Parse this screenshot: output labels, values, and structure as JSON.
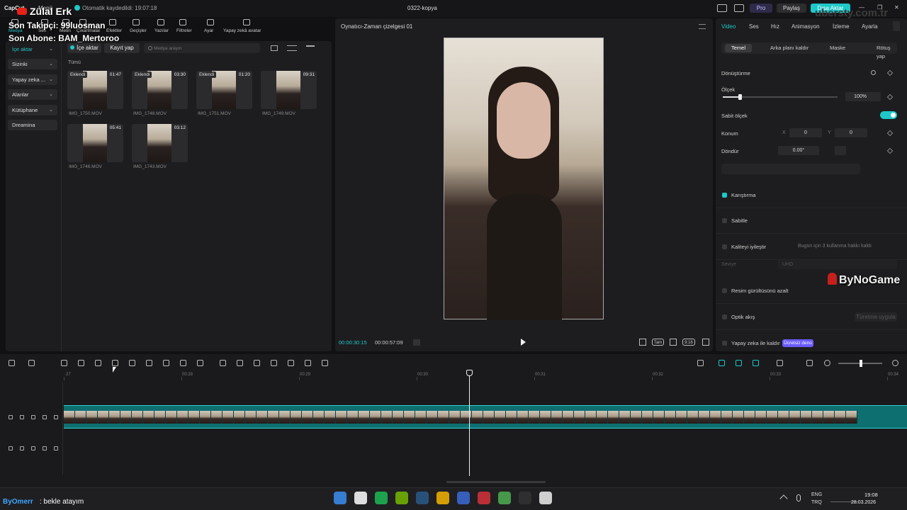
{
  "overlay": {
    "channel": "Zülal Erk",
    "follower": "Son Takipçi: 99luosman",
    "subscriber": "Son Abone: BAM_Mertoroo",
    "watermark": "ByNoGame",
    "site": "ubersty.com.tr",
    "chat_user": "ByOmerr",
    "chat_msg": ": bekle atayım"
  },
  "titlebar": {
    "app": "CapCut",
    "menu": "Menü",
    "autosave": "Otomatik kaydedildi: 19:07:18",
    "project": "0322-kopya",
    "pro": "Pro",
    "share": "Paylaş",
    "export": "Dışa Aktar",
    "min": "—",
    "max": "❐",
    "close": "✕"
  },
  "toolbar": {
    "items": [
      "Medya",
      "Ses",
      "Metin",
      "Çıkartmalar",
      "Efektler",
      "Geçişler",
      "Yazılar",
      "Filtreler",
      "Ayar",
      "Yapay zekâ avatar"
    ]
  },
  "media": {
    "sidebar": [
      "İçe aktar",
      "Sizinki",
      "Yapay zeka ...",
      "Alanlar",
      "Kütüphane",
      "Dreamina"
    ],
    "import_btn": "İçe aktar",
    "record_btn": "Kayıt yap",
    "search_placeholder": "Medya arayın",
    "all": "Tümü",
    "clips": [
      {
        "badge": "Eklendi",
        "dur": "01:47",
        "name": "IMG_1750.MOV"
      },
      {
        "badge": "Eklendi",
        "dur": "03:30",
        "name": "IMG_1748.MOV"
      },
      {
        "badge": "Eklendi",
        "dur": "01:20",
        "name": "IMG_1751.MOV"
      },
      {
        "badge": "",
        "dur": "09:31",
        "name": "IMG_1749.MOV"
      },
      {
        "badge": "",
        "dur": "05:41",
        "name": "IMG_1746.MOV"
      },
      {
        "badge": "",
        "dur": "03:12",
        "name": "IMG_1743.MOV"
      }
    ]
  },
  "player": {
    "title": "Oynatıcı-Zaman çizelgesi 01",
    "current": "00:00:30:15",
    "total": "00:00:57:09",
    "ratio": "9:16",
    "full": "Tam"
  },
  "props": {
    "tabs": [
      "Video",
      "Ses",
      "Hız",
      "Animasyon",
      "İzleme",
      "Ayarla"
    ],
    "subtabs": [
      "Temel",
      "Arka planı kaldır",
      "Maske",
      "Rötuş yap"
    ],
    "transform": "Dönüştürme",
    "scale": "Ölçek",
    "scale_val": "100%",
    "scale_fraction": 0.15,
    "uniform": "Sabit ölçek",
    "position": "Konum",
    "x_label": "X",
    "x_val": "0",
    "y_label": "Y",
    "y_val": "0",
    "rotate": "Döndür",
    "rotate_val": "0.00°",
    "blend": "Karıştırma",
    "stabilize": "Sabitle",
    "enhance": "Kaliteyi iyileştir",
    "enhance_note": "Bugün için 3 kullanma hakkı kaldı",
    "level": "Seviye",
    "level_val": "UHD",
    "denoise": "Resim gürültüsünü azalt",
    "flow": "Optik akış",
    "flow_btn": "Türetme uygula",
    "remove": "Yapay zeka ile kaldır",
    "free": "Ücretsiz deno"
  },
  "timeline": {
    "ticks": [
      "·27",
      "00:28",
      "00:29",
      "00:30",
      "00:31",
      "00:32",
      "00:33",
      "00:34"
    ]
  },
  "taskbar": {
    "lang1": "ENG",
    "lang2": "TRQ",
    "time": "19:08",
    "date": "28.03.2026"
  },
  "colors": {
    "accent": "#1fc8c8",
    "purple": "#6b5cff",
    "clip": "#0e6f70"
  }
}
